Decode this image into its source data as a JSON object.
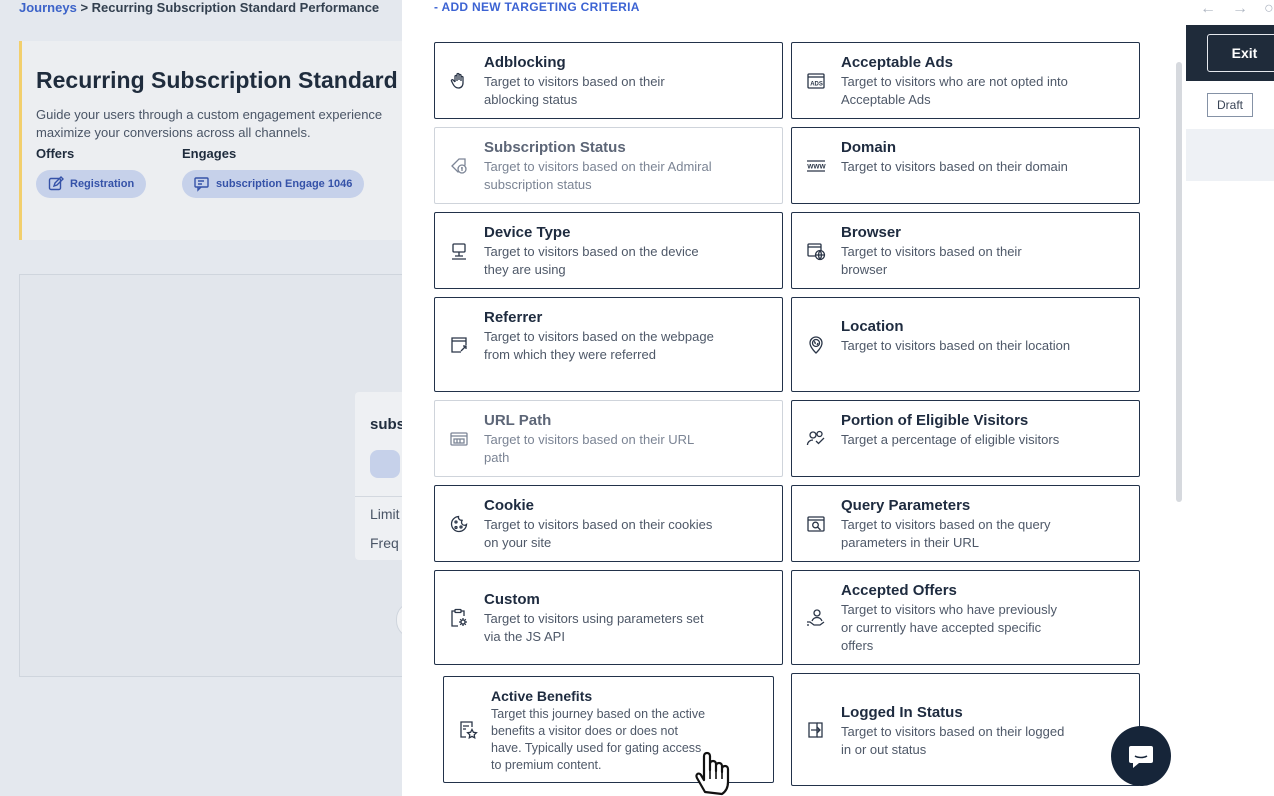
{
  "breadcrumb": {
    "link": "Journeys",
    "separator": ">",
    "current": "Recurring Subscription Standard Performance"
  },
  "hero": {
    "title": "Recurring Subscription Standard",
    "description": "Guide your users through a custom engagement experience maximize your conversions across all channels.",
    "offers_label": "Offers",
    "engages_label": "Engages",
    "offer_pill": "Registration",
    "engage_pill": "subscription Engage 1046"
  },
  "sub_card": {
    "title": "subs",
    "line1": "Limit",
    "line2": "Freq"
  },
  "rail": {
    "exit": "Exit",
    "draft": "Draft",
    "back": "←",
    "forward": "→",
    "reload": "○"
  },
  "panel": {
    "add_criteria": "- ADD NEW TARGETING CRITERIA",
    "criteria": [
      {
        "title": "Adblocking",
        "desc": "Target to visitors based on their ablocking status",
        "icon": "hand-icon"
      },
      {
        "title": "Acceptable Ads",
        "desc": "Target to visitors who are not opted into Acceptable Ads",
        "icon": "ads-icon"
      },
      {
        "title": "Subscription Status",
        "desc": "Target to visitors based on their Admiral subscription status",
        "icon": "tag-dollar-icon"
      },
      {
        "title": "Domain",
        "desc": "Target to visitors based on their domain",
        "icon": "www-icon"
      },
      {
        "title": "Device Type",
        "desc": "Target to visitors based on the device they are using",
        "icon": "monitor-icon"
      },
      {
        "title": "Browser",
        "desc": "Target to visitors based on their browser",
        "icon": "browser-globe-icon"
      },
      {
        "title": "Referrer",
        "desc": "Target to visitors based on the webpage from which they were referred",
        "icon": "referrer-icon"
      },
      {
        "title": "Location",
        "desc": "Target to visitors based on their location",
        "icon": "location-pin-icon"
      },
      {
        "title": "URL Path",
        "desc": "Target to visitors based on their URL path",
        "icon": "url-path-icon"
      },
      {
        "title": "Portion of Eligible Visitors",
        "desc": "Target a percentage of eligible visitors",
        "icon": "users-check-icon"
      },
      {
        "title": "Cookie",
        "desc": "Target to visitors based on their cookies on your site",
        "icon": "cookie-icon"
      },
      {
        "title": "Query Parameters",
        "desc": "Target to visitors based on the query parameters in their URL",
        "icon": "query-search-icon"
      },
      {
        "title": "Custom",
        "desc": "Target to visitors using parameters set via the JS API",
        "icon": "clipboard-gear-icon"
      },
      {
        "title": "Accepted Offers",
        "desc": "Target to visitors who have previously or currently have accepted specific offers",
        "icon": "user-hand-icon"
      },
      {
        "title": "Active Benefits",
        "desc": "Target this journey based on the active benefits a visitor does or does not have. Typically used for gating access to premium content.",
        "icon": "benefit-star-icon"
      },
      {
        "title": "Logged In Status",
        "desc": "Target to visitors based on their logged in or out status",
        "icon": "login-door-icon"
      }
    ]
  }
}
